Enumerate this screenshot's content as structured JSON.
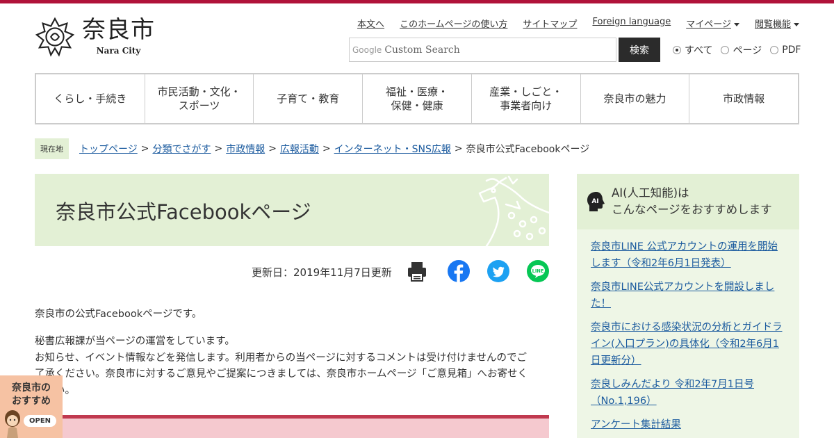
{
  "brand": {
    "name_ja": "奈良市",
    "name_en": "Nara City"
  },
  "utility_nav": [
    {
      "label": "本文へ"
    },
    {
      "label": "このホームページの使い方"
    },
    {
      "label": "サイトマップ"
    },
    {
      "label": "Foreign language"
    },
    {
      "label": "マイページ"
    },
    {
      "label": "閲覧機能"
    }
  ],
  "search": {
    "brand": "Google",
    "placeholder": "Custom Search",
    "button_label": "検索",
    "scopes": [
      {
        "label": "すべて",
        "selected": true
      },
      {
        "label": "ページ",
        "selected": false
      },
      {
        "label": "PDF",
        "selected": false
      }
    ]
  },
  "global_nav": [
    {
      "label": "くらし・手続き"
    },
    {
      "label": "市民活動・文化・\nスポーツ"
    },
    {
      "label": "子育て・教育"
    },
    {
      "label": "福祉・医療・\n保健・健康"
    },
    {
      "label": "産業・しごと・\n事業者向け"
    },
    {
      "label": "奈良市の魅力"
    },
    {
      "label": "市政情報"
    }
  ],
  "breadcrumb": {
    "here_label": "現在地",
    "items": [
      {
        "label": "トップページ"
      },
      {
        "label": "分類でさがす"
      },
      {
        "label": "市政情報"
      },
      {
        "label": "広報活動"
      },
      {
        "label": "インターネット・SNS広報"
      }
    ],
    "separator": ">",
    "current": "奈良市公式Facebookページ"
  },
  "page": {
    "title": "奈良市公式Facebookページ",
    "updated": "更新日：2019年11月7日更新",
    "paragraph1": "奈良市の公式Facebookページです。",
    "paragraph2_line1": "秘書広報課が当ページの運営をしています。",
    "paragraph2_line2": "お知らせ、イベント情報などを発信します。利用者からの当ページに対するコメントは受け付けませんのでご",
    "paragraph2_line3": "了承ください。奈良市に対するご意見やご提案につきましては、奈良市ホームページ「ご意見箱」へお寄せく",
    "paragraph2_line4": "ださい。"
  },
  "share_icons": [
    "print-icon",
    "facebook-icon",
    "twitter-icon",
    "line-icon"
  ],
  "recommend_badge": {
    "label": "奈良市の\nおすすめ",
    "open_label": "OPEN"
  },
  "ai_panel": {
    "icon_text": "AI",
    "title_line1": "AI(人工知能)は",
    "title_line2": "こんなページをおすすめします",
    "links": [
      {
        "label": "奈良市LINE 公式アカウントの運用を開始します（令和2年6月1日発表）"
      },
      {
        "label": "奈良市LINE公式アカウントを開設しました！"
      },
      {
        "label": "奈良市における感染状況の分析とガイドライン(入口プラン)の具体化（令和2年6月1日更新分）"
      },
      {
        "label": "奈良しみんだより 令和2年7月1日号（No.1,196）"
      },
      {
        "label": "アンケート集計結果"
      }
    ]
  },
  "colors": {
    "accent": "#b0133a",
    "banner_green": "#e3f0d5",
    "link": "#1a5a9e",
    "facebook": "#1877f2",
    "twitter": "#1da1f2",
    "line": "#06c755"
  }
}
